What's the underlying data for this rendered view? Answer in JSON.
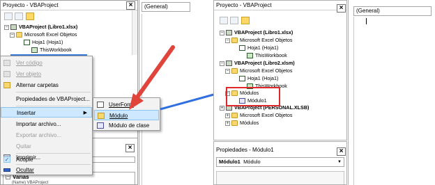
{
  "left": {
    "project_title": "Proyecto - VBAProject",
    "code_combo": "(General)",
    "tree": [
      {
        "label": "VBAProject (Libro1.xlsx)",
        "bold": true
      },
      {
        "label": "Microsoft Excel Objetos"
      },
      {
        "label": "Hoja1 (Hoja1)"
      },
      {
        "label": "ThisWorkbook"
      }
    ],
    "context_menu": [
      {
        "label": "Ver código",
        "disabled": true
      },
      {
        "label": "Ver objeto",
        "disabled": true
      },
      {
        "label": "Alternar carpetas"
      },
      {
        "label": "Propiedades de VBAProject..."
      },
      {
        "label": "Insertar"
      },
      {
        "label": "Importar archivo..."
      },
      {
        "label": "Exportar archivo...",
        "disabled": true
      },
      {
        "label": "Quitar",
        "disabled": true
      },
      {
        "label": "Imprimir..."
      },
      {
        "label": "Acople"
      },
      {
        "label": "Ocultar"
      }
    ],
    "submenu": [
      {
        "label": "UserForm"
      },
      {
        "label": "Módulo"
      },
      {
        "label": "Módulo de clase"
      }
    ],
    "bottom_tab": "Varias",
    "bottom_row": "(Name) VBAProject"
  },
  "right": {
    "project_title": "Proyecto - VBAProject",
    "code_combo": "(General)",
    "tree": [
      {
        "label": "VBAProject (Libro1.xlsx)",
        "bold": true
      },
      {
        "label": "Microsoft Excel Objetos"
      },
      {
        "label": "Hoja1 (Hoja1)"
      },
      {
        "label": "ThisWorkbook"
      },
      {
        "label": "VBAProject (Libro2.xlsm)",
        "bold": true
      },
      {
        "label": "Microsoft Excel Objetos"
      },
      {
        "label": "Hoja1 (Hoja1)"
      },
      {
        "label": "ThisWorkbook"
      },
      {
        "label": "Módulos"
      },
      {
        "label": "Módulo1"
      },
      {
        "label": "VBAProject (PERSONAL.XLSB)",
        "bold": true
      },
      {
        "label": "Microsoft Excel Objetos"
      },
      {
        "label": "Módulos"
      }
    ],
    "props_title": "Propiedades - Módulo1",
    "props_combo_name": "Módulo1",
    "props_combo_type": "Módulo"
  },
  "colors": {
    "arrow_red": "#e0443a",
    "arrow_blue": "#2f6fe0",
    "highlight_box": "#e0282c",
    "menu_highlight": "#cde8ff"
  }
}
